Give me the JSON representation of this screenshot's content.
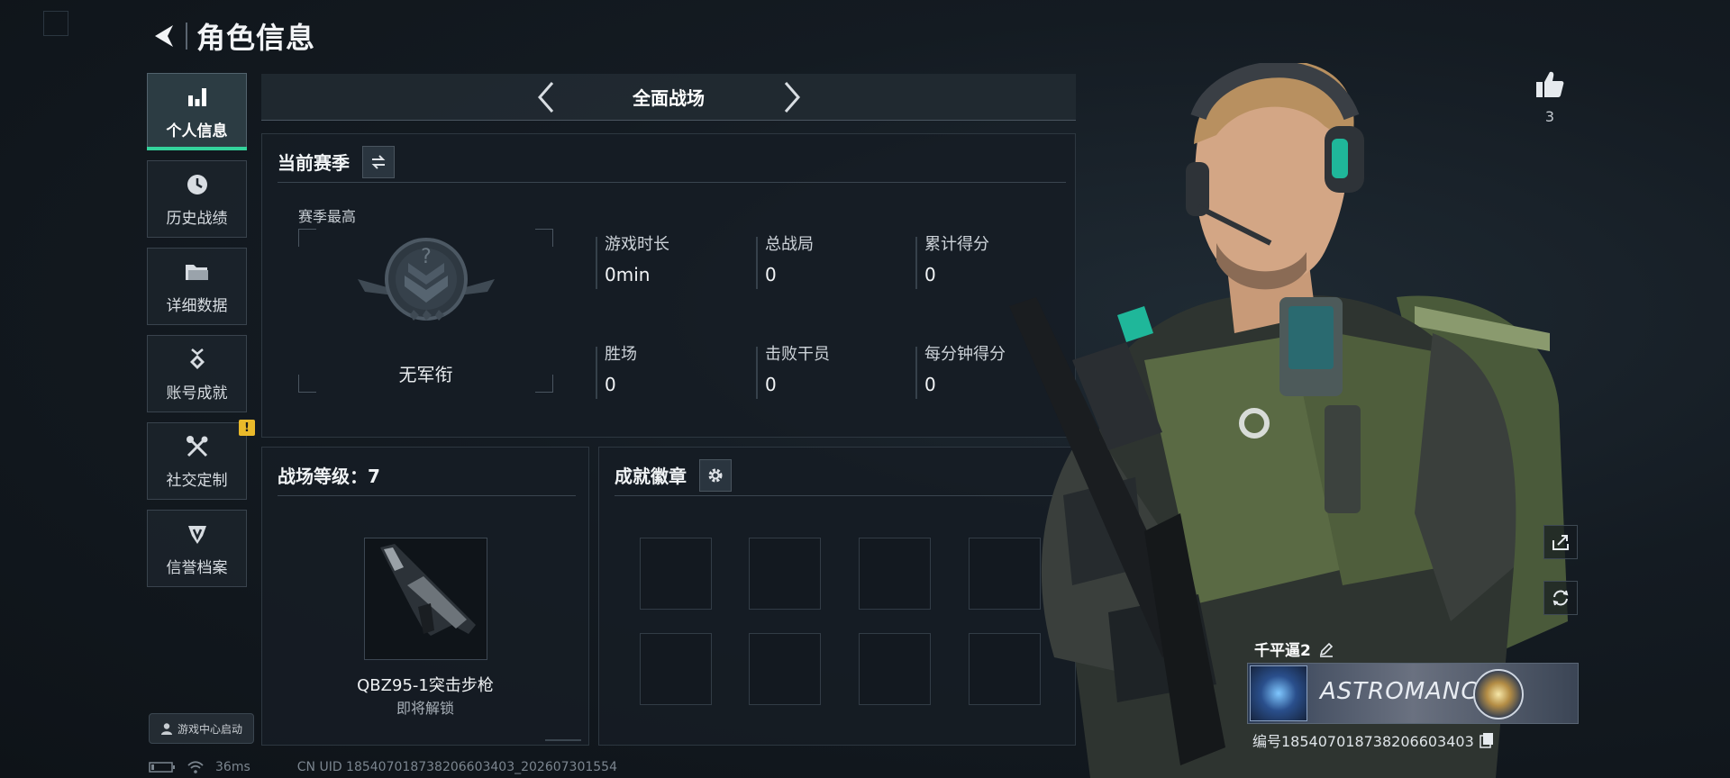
{
  "header": {
    "title": "角色信息"
  },
  "sidebar": {
    "items": [
      {
        "label": "个人信息",
        "icon": "bar-chart-icon",
        "active": true
      },
      {
        "label": "历史战绩",
        "icon": "clock-icon",
        "active": false
      },
      {
        "label": "详细数据",
        "icon": "folder-icon",
        "active": false
      },
      {
        "label": "账号成就",
        "icon": "medal-icon",
        "active": false
      },
      {
        "label": "社交定制",
        "icon": "tools-icon",
        "active": false,
        "badge": "!"
      },
      {
        "label": "信誉档案",
        "icon": "shield-icon",
        "active": false
      }
    ],
    "launch_label": "游戏中心启动"
  },
  "mode": {
    "name": "全面战场"
  },
  "season": {
    "title": "当前赛季",
    "best_label": "赛季最高",
    "rank_name": "无军衔",
    "stats": [
      {
        "label": "游戏时长",
        "value": "0min"
      },
      {
        "label": "总战局",
        "value": "0"
      },
      {
        "label": "累计得分",
        "value": "0"
      },
      {
        "label": "胜场",
        "value": "0"
      },
      {
        "label": "击败干员",
        "value": "0"
      },
      {
        "label": "每分钟得分",
        "value": "0"
      }
    ]
  },
  "level": {
    "title": "战场等级：7",
    "weapon_name": "QBZ95-1突击步枪",
    "weapon_status": "即将解锁"
  },
  "achievements": {
    "title": "成就徽章",
    "slots": 8
  },
  "character": {
    "likes": "3"
  },
  "namecard": {
    "player_name": "千平逼2",
    "card_text": "ASTROMANCY",
    "uid_line": "编号1854070187382066034​03"
  },
  "statusbar": {
    "ping": "36ms",
    "uid_footer": "CN UID 185407018738206603403_202607301554"
  },
  "colors": {
    "accent": "#34d39c",
    "badge": "#e9b92a",
    "panel": "#161d24"
  }
}
